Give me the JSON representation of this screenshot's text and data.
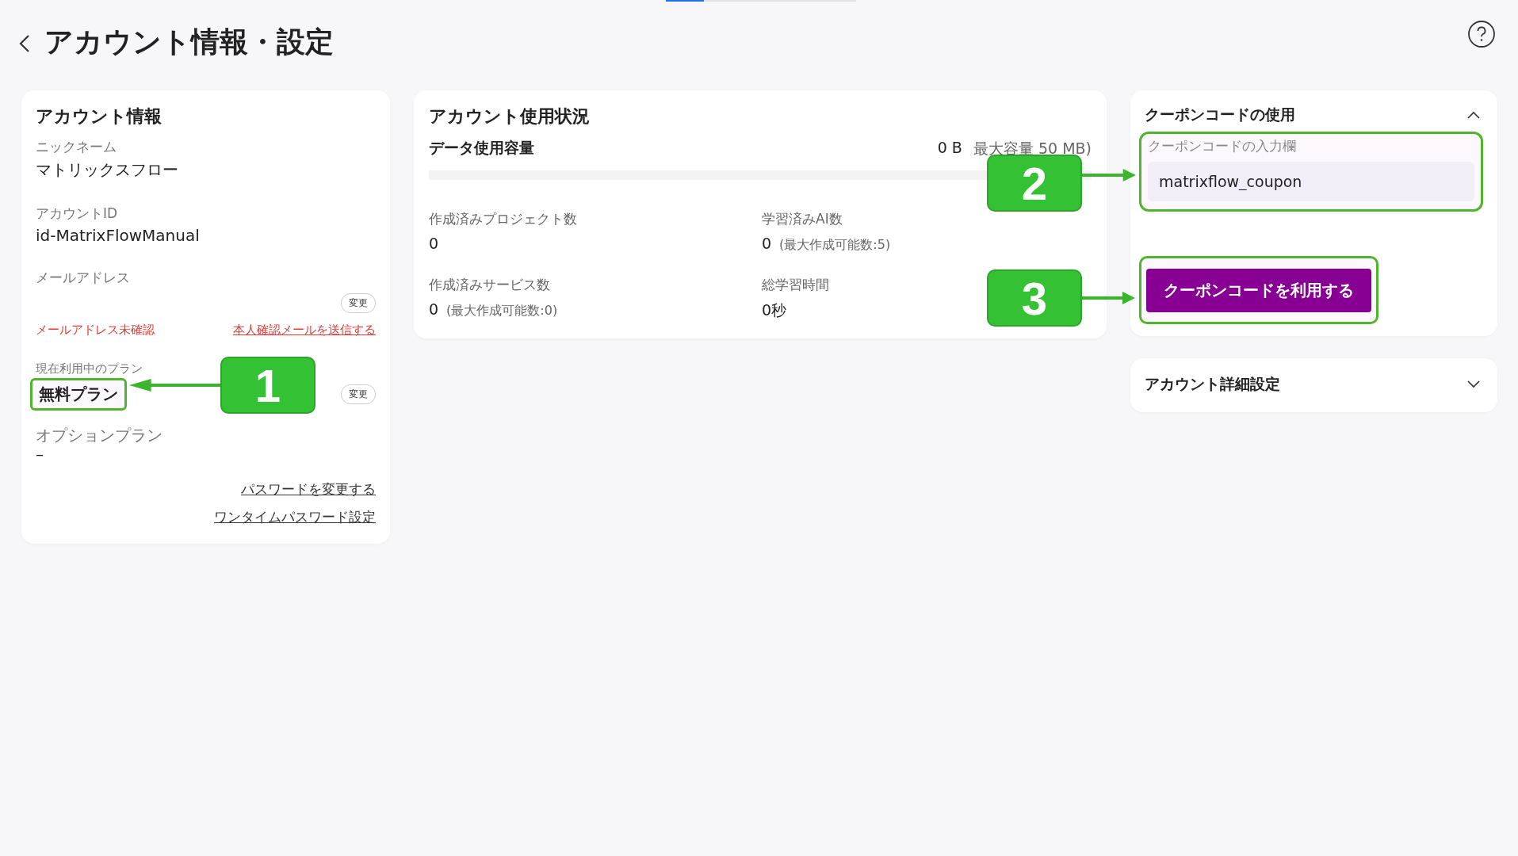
{
  "header": {
    "title": "アカウント情報・設定"
  },
  "account_info": {
    "title": "アカウント情報",
    "nickname": {
      "label": "ニックネーム",
      "value": "マトリックスフロー"
    },
    "account_id": {
      "label": "アカウントID",
      "value": "id-MatrixFlowManual"
    },
    "email": {
      "label": "メールアドレス",
      "change_button": "変更",
      "status": "メールアドレス未確認",
      "verify_link": "本人確認メールを送信する"
    },
    "plan": {
      "label": "現在利用中のプラン",
      "value": "無料プラン",
      "change_button": "変更",
      "highlighted": true
    },
    "option_plan": {
      "label": "オプションプラン",
      "value": "–"
    },
    "links": [
      "パスワードを変更する",
      "ワンタイムパスワード設定"
    ]
  },
  "usage": {
    "title": "アカウント使用状況",
    "data": {
      "label": "データ使用容量",
      "used": "0 B",
      "max": "最大容量 50 MB)",
      "level": 0
    },
    "stats": [
      {
        "label": "作成済みプロジェクト数",
        "value": "0"
      },
      {
        "label": "学習済みAI数",
        "value": "0",
        "note": "(最大作成可能数:5)"
      },
      {
        "label": "作成済みサービス数",
        "value": "0",
        "note": "(最大作成可能数:0)"
      },
      {
        "label": "総学習時間",
        "value": "0秒"
      }
    ]
  },
  "coupon": {
    "title": "クーポンコードの使用",
    "expanded": true,
    "field_label": "クーポンコードの入力欄",
    "value": "matrixflow_coupon",
    "field_highlighted": true,
    "button": "クーポンコードを利用する",
    "button_highlighted": true
  },
  "advanced": {
    "title": "アカウント詳細設定",
    "expanded": false
  },
  "annotations": [
    {
      "number": "1"
    },
    {
      "number": "2"
    },
    {
      "number": "3"
    }
  ]
}
